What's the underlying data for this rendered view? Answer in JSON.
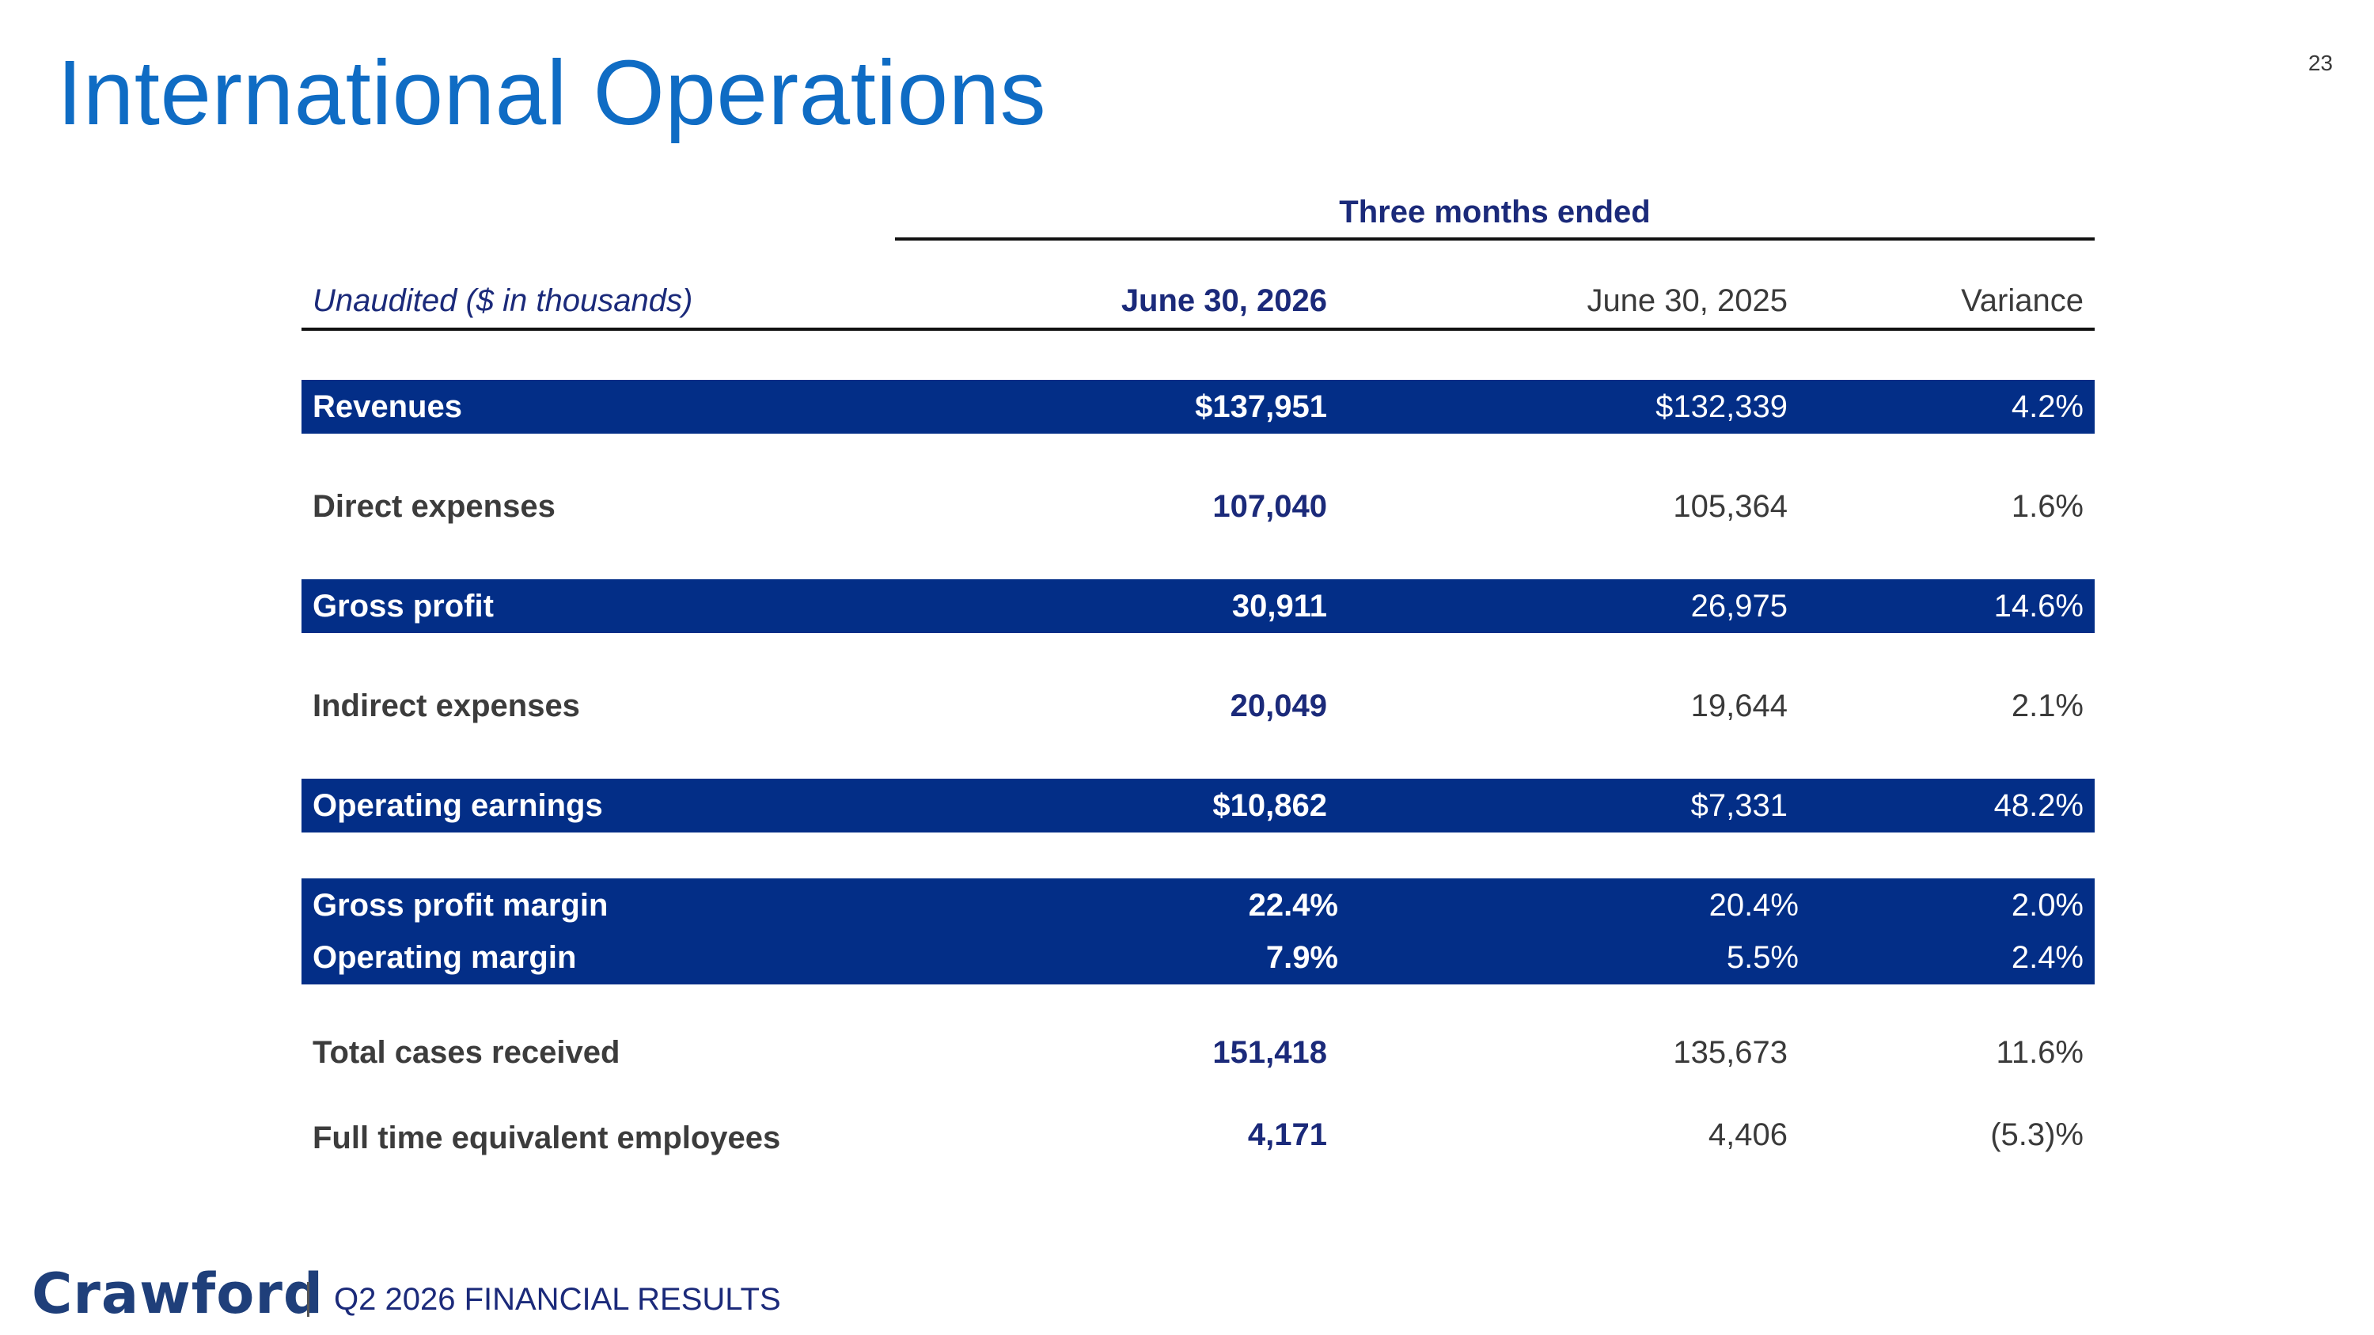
{
  "page_number": "23",
  "title": "International Operations",
  "table": {
    "section_header": "Three months ended",
    "columns": {
      "label": "Unaudited ($ in thousands)",
      "current": "June 30, 2026",
      "prior": "June 30, 2025",
      "variance": "Variance"
    },
    "rows": [
      {
        "label": "Revenues",
        "current": "$137,951",
        "prior": "$132,339",
        "variance": "4.2%"
      },
      {
        "label": "Direct expenses",
        "current": "107,040",
        "prior": "105,364",
        "variance": "1.6%"
      },
      {
        "label": "Gross profit",
        "current": "30,911",
        "prior": "26,975",
        "variance": "14.6%"
      },
      {
        "label": "Indirect expenses",
        "current": "20,049",
        "prior": "19,644",
        "variance": "2.1%"
      },
      {
        "label": "Operating earnings",
        "current": "$10,862",
        "prior": "$7,331",
        "variance": "48.2%"
      },
      {
        "label": "Gross profit margin",
        "current": "22.4%",
        "prior": "20.4%",
        "variance": "2.0%"
      },
      {
        "label": "Operating margin",
        "current": "7.9%",
        "prior": "5.5%",
        "variance": "2.4%"
      },
      {
        "label": "Total cases received",
        "current": "151,418",
        "prior": "135,673",
        "variance": "11.6%"
      },
      {
        "label": "Full time equivalent employees",
        "current": "4,171",
        "prior": "4,406",
        "variance": "(5.3)%"
      }
    ]
  },
  "footer": {
    "logo": "Crawford",
    "text": "Q2 2026 FINANCIAL RESULTS"
  },
  "colors": {
    "title": "#0f6cc4",
    "band": "#032e87",
    "accent_text": "#1b2a7a"
  }
}
